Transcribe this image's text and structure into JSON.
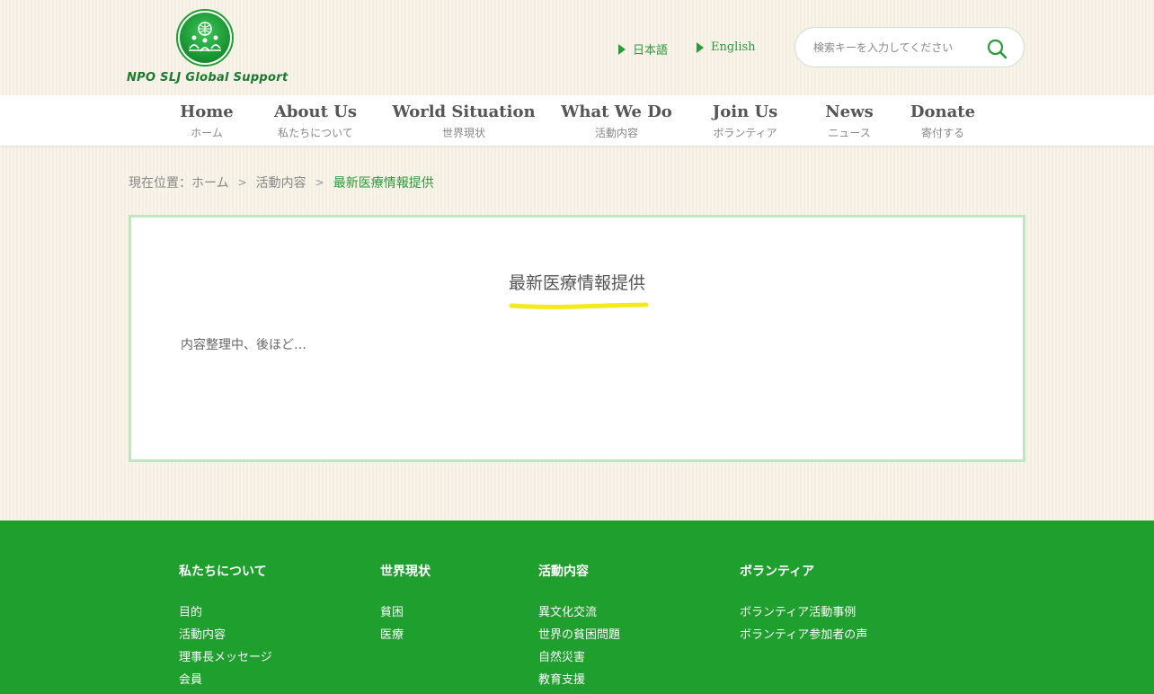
{
  "header": {
    "logo_text": "NPO SLJ Global Support",
    "lang_ja": "日本語",
    "lang_en": "English",
    "search_placeholder": "検索キーを入力してください"
  },
  "nav": [
    {
      "en": "Home",
      "ja": "ホーム"
    },
    {
      "en": "About Us",
      "ja": "私たちについて"
    },
    {
      "en": "World Situation",
      "ja": "世界現状"
    },
    {
      "en": "What We Do",
      "ja": "活動内容"
    },
    {
      "en": "Join Us",
      "ja": "ボランティア"
    },
    {
      "en": "News",
      "ja": "ニュース"
    },
    {
      "en": "Donate",
      "ja": "寄付する"
    }
  ],
  "breadcrumb": {
    "label": "現在位置：",
    "home": "ホーム",
    "parent": "活動内容",
    "current": "最新医療情報提供"
  },
  "content": {
    "title": "最新医療情報提供",
    "body": "内容整理中、後ほど…"
  },
  "footer": {
    "columns": [
      {
        "title": "私たちについて",
        "links": [
          "目的",
          "活動内容",
          "理事長メッセージ",
          "会員"
        ]
      },
      {
        "title": "世界現状",
        "links": [
          "貧困",
          "医療"
        ]
      },
      {
        "title": "活動内容",
        "links": [
          "異文化交流",
          "世界の貧困問題",
          "自然災害",
          "教育支援"
        ]
      },
      {
        "title": "ボランティア",
        "links": [
          "ボランティア活動事例",
          "ボランティア参加者の声"
        ]
      }
    ]
  },
  "colors": {
    "brand_green": "#1e9f2e",
    "accent_yellow": "#f5ea1c",
    "content_border": "#bfe5c3"
  }
}
